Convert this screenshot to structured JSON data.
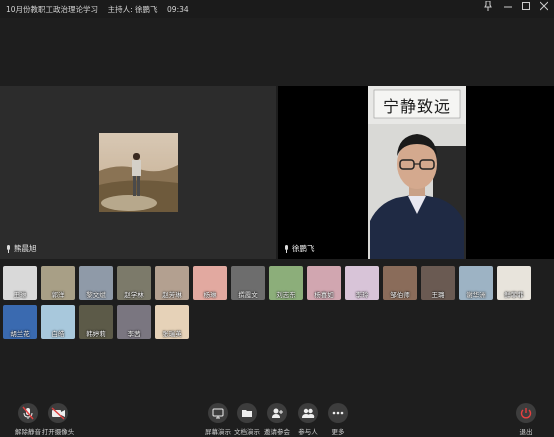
{
  "titlebar": {
    "title": "10月份教职工政治理论学习    主持人: 徐鹏飞    09:34"
  },
  "videos": {
    "left_name": "熊晨旭",
    "right_name": "徐鹏飞",
    "banner_text": "宁静致远"
  },
  "participants": [
    {
      "name": "王琳",
      "bg": "#d9d9d9"
    },
    {
      "name": "郭洋",
      "bg": "#a89f86"
    },
    {
      "name": "黎文斌",
      "bg": "#8f9aa8"
    },
    {
      "name": "赵学林",
      "bg": "#7c7a6a"
    },
    {
      "name": "赵芳琳",
      "bg": "#b3a090"
    },
    {
      "name": "杨琳",
      "bg": "#e2a9a0"
    },
    {
      "name": "撰霞文",
      "bg": "#6d6d6d"
    },
    {
      "name": "刘志东",
      "bg": "#8cae7a"
    },
    {
      "name": "杨喜如",
      "bg": "#d1a6b0"
    },
    {
      "name": "李玲",
      "bg": "#d8c4d8"
    },
    {
      "name": "邹伯师",
      "bg": "#8a6c5a"
    },
    {
      "name": "王璐",
      "bg": "#6a5a52"
    },
    {
      "name": "谢华洲",
      "bg": "#9db3c4"
    },
    {
      "name": "鲜菲菲",
      "bg": "#e8e4dc"
    },
    {
      "name": "胡兰花",
      "bg": "#3a6ab0"
    },
    {
      "name": "白皓",
      "bg": "#a8c8dc"
    },
    {
      "name": "韩婷莉",
      "bg": "#5c5a48"
    },
    {
      "name": "李茜",
      "bg": "#7a7680"
    },
    {
      "name": "张瑞英",
      "bg": "#e6d2b8"
    }
  ],
  "toolbar": {
    "unmute": "解除静音",
    "camera": "打开摄像头",
    "share": "屏幕演示",
    "doc": "文档演示",
    "invite": "邀请参会",
    "members": "参与人",
    "more": "更多",
    "leave": "退出"
  }
}
